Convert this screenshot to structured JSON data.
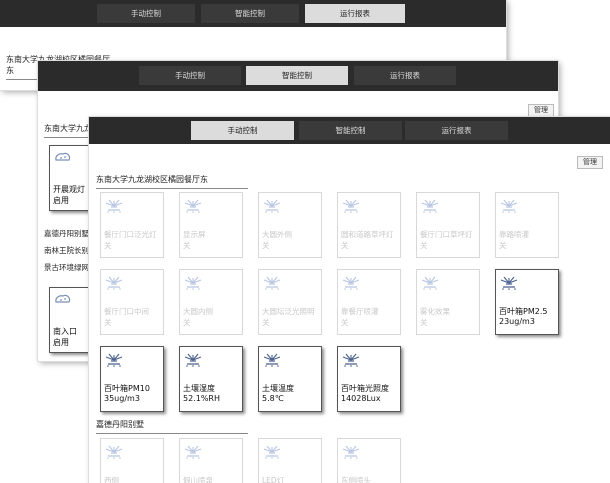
{
  "windows": {
    "w1": {
      "tabs": [
        "手动控制",
        "智能控制",
        "运行报表"
      ],
      "active_tab": 2,
      "section_title": "东南大学九龙湖校区橘园餐厅东"
    },
    "w2": {
      "tabs": [
        "手动控制",
        "智能控制",
        "运行报表"
      ],
      "active_tab": 1,
      "manage_label": "管理",
      "section_title": "东南大学九龙",
      "tile1": {
        "name": "开晨观灯",
        "state": "启用"
      },
      "list": [
        "嘉德丹阳别墅",
        "南林王院长别",
        "景古环境绿网"
      ],
      "tile2": {
        "name": "南入口",
        "state": "启用"
      }
    },
    "w3": {
      "tabs": [
        "手动控制",
        "智能控制",
        "运行报表"
      ],
      "active_tab": 0,
      "manage_label": "管理",
      "sections": [
        {
          "title": "东南大学九龙湖校区橘园餐厅东",
          "tiles": [
            {
              "name": "餐厅门口泛光灯",
              "state": "关",
              "on": false
            },
            {
              "name": "显示屏",
              "state": "关",
              "on": false
            },
            {
              "name": "大圆外侧",
              "state": "关",
              "on": false
            },
            {
              "name": "圆和道路草坪灯",
              "state": "关",
              "on": false
            },
            {
              "name": "餐厅门口草坪灯",
              "state": "关",
              "on": false
            },
            {
              "name": "靠路喷灌",
              "state": "关",
              "on": false
            },
            {
              "name": "餐厅门口中间",
              "state": "关",
              "on": false
            },
            {
              "name": "大圆内侧",
              "state": "关",
              "on": false
            },
            {
              "name": "大圆坛泛光照明",
              "state": "关",
              "on": false
            },
            {
              "name": "靠餐厅喷灌",
              "state": "关",
              "on": false
            },
            {
              "name": "雾化效果",
              "state": "关",
              "on": false
            },
            {
              "name": "百叶箱PM2.5",
              "state": "23ug/m3",
              "on": true
            },
            {
              "name": "百叶箱PM10",
              "state": "35ug/m3",
              "on": true
            },
            {
              "name": "土壤湿度",
              "state": "52.1%RH",
              "on": true
            },
            {
              "name": "土壤温度",
              "state": "5.8℃",
              "on": true
            },
            {
              "name": "百叶箱光照度",
              "state": "14028Lux",
              "on": true
            }
          ]
        },
        {
          "title": "嘉德丹阳别墅",
          "tiles": [
            {
              "name": "西侧",
              "state": "",
              "on": false
            },
            {
              "name": "假山喷泉",
              "state": "",
              "on": false
            },
            {
              "name": "LED灯",
              "state": "",
              "on": false
            },
            {
              "name": "东侧喷头",
              "state": "",
              "on": false
            }
          ]
        }
      ]
    }
  },
  "colors": {
    "topbar": "#2b2b2b",
    "active_tab": "#dcdcdc",
    "icon": "#7a8fb8"
  },
  "icons": {
    "tile": "sprinkler-icon"
  }
}
